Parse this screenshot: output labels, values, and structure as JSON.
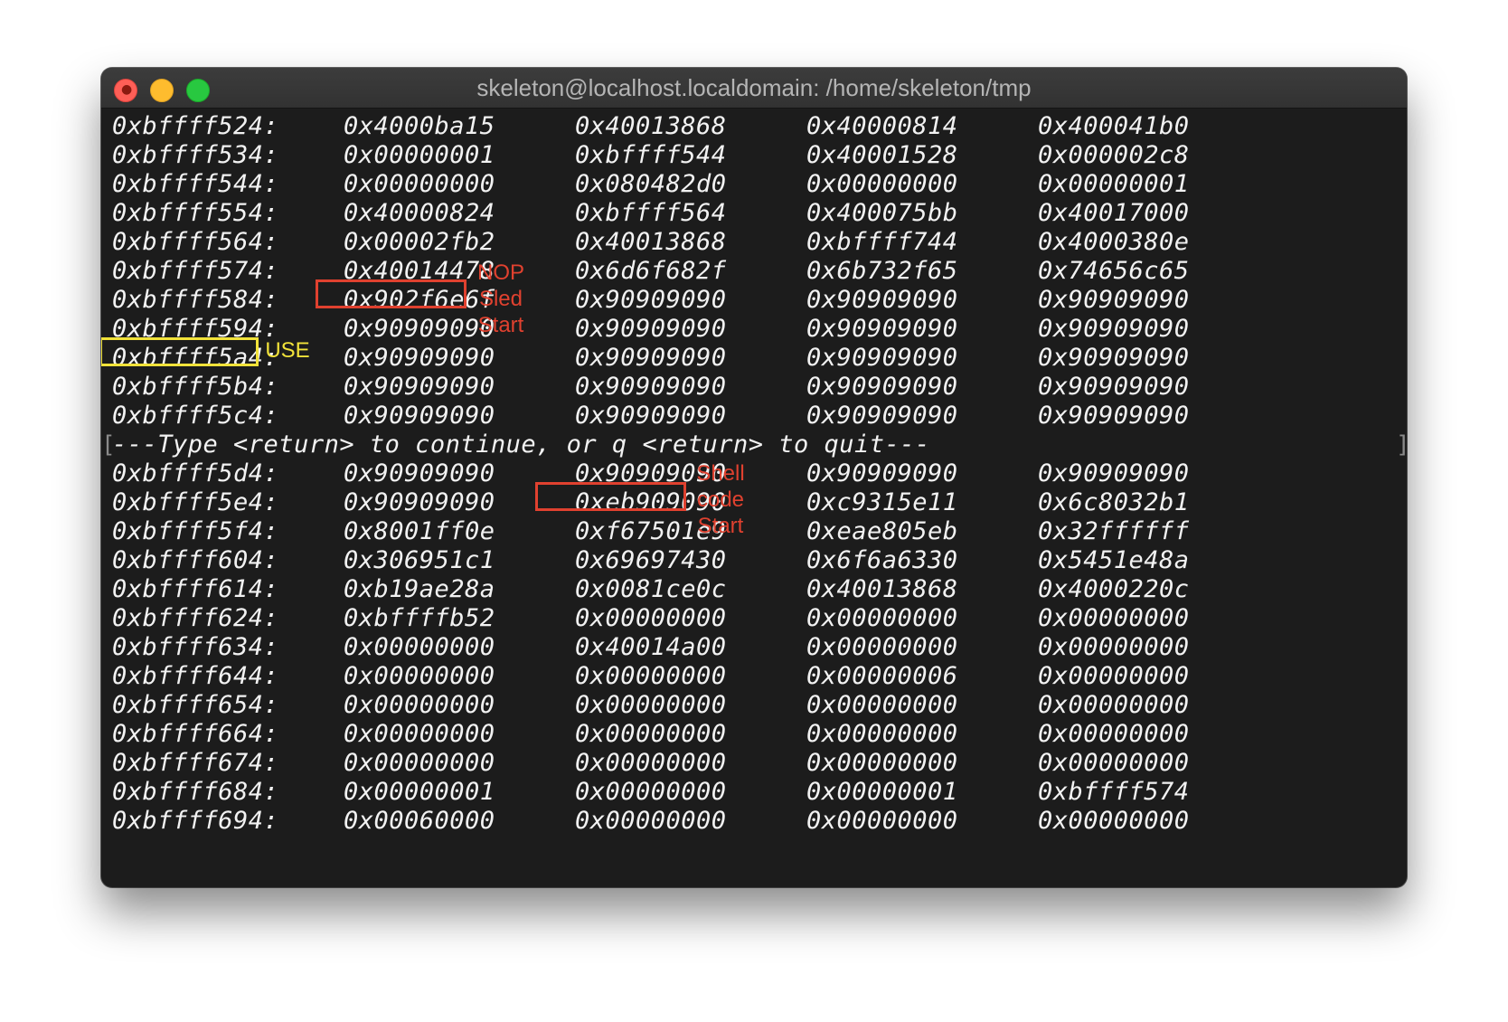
{
  "window": {
    "title": "skeleton@localhost.localdomain: /home/skeleton/tmp",
    "controls": {
      "close": "close-button",
      "minimize": "minimize-button",
      "zoom": "zoom-button"
    }
  },
  "colors": {
    "terminal_bg": "#1c1c1c",
    "text": "#f2f2f2",
    "highlight_red": "#e0412f",
    "highlight_yellow": "#f1e23a"
  },
  "rows": [
    [
      "0xbffff524:",
      "0x4000ba15",
      "0x40013868",
      "0x40000814",
      "0x400041b0"
    ],
    [
      "0xbffff534:",
      "0x00000001",
      "0xbffff544",
      "0x40001528",
      "0x000002c8"
    ],
    [
      "0xbffff544:",
      "0x00000000",
      "0x080482d0",
      "0x00000000",
      "0x00000001"
    ],
    [
      "0xbffff554:",
      "0x40000824",
      "0xbffff564",
      "0x400075bb",
      "0x40017000"
    ],
    [
      "0xbffff564:",
      "0x00002fb2",
      "0x40013868",
      "0xbffff744",
      "0x4000380e"
    ],
    [
      "0xbffff574:",
      "0x40014478",
      "0x6d6f682f",
      "0x6b732f65",
      "0x74656c65"
    ],
    [
      "0xbffff584:",
      "0x902f6e6f",
      "0x90909090",
      "0x90909090",
      "0x90909090"
    ],
    [
      "0xbffff594:",
      "0x90909090",
      "0x90909090",
      "0x90909090",
      "0x90909090"
    ],
    [
      "0xbffff5a4:",
      "0x90909090",
      "0x90909090",
      "0x90909090",
      "0x90909090"
    ],
    [
      "0xbffff5b4:",
      "0x90909090",
      "0x90909090",
      "0x90909090",
      "0x90909090"
    ],
    [
      "0xbffff5c4:",
      "0x90909090",
      "0x90909090",
      "0x90909090",
      "0x90909090"
    ]
  ],
  "prompt": "---Type <return> to continue, or q <return> to quit---",
  "rows2": [
    [
      "0xbffff5d4:",
      "0x90909090",
      "0x90909090",
      "0x90909090",
      "0x90909090"
    ],
    [
      "0xbffff5e4:",
      "0x90909090",
      "0xeb909090",
      "0xc9315e11",
      "0x6c8032b1"
    ],
    [
      "0xbffff5f4:",
      "0x8001ff0e",
      "0xf67501e9",
      "0xeae805eb",
      "0x32ffffff"
    ],
    [
      "0xbffff604:",
      "0x306951c1",
      "0x69697430",
      "0x6f6a6330",
      "0x5451e48a"
    ],
    [
      "0xbffff614:",
      "0xb19ae28a",
      "0x0081ce0c",
      "0x40013868",
      "0x4000220c"
    ],
    [
      "0xbffff624:",
      "0xbffffb52",
      "0x00000000",
      "0x00000000",
      "0x00000000"
    ],
    [
      "0xbffff634:",
      "0x00000000",
      "0x40014a00",
      "0x00000000",
      "0x00000000"
    ],
    [
      "0xbffff644:",
      "0x00000000",
      "0x00000000",
      "0x00000006",
      "0x00000000"
    ],
    [
      "0xbffff654:",
      "0x00000000",
      "0x00000000",
      "0x00000000",
      "0x00000000"
    ],
    [
      "0xbffff664:",
      "0x00000000",
      "0x00000000",
      "0x00000000",
      "0x00000000"
    ],
    [
      "0xbffff674:",
      "0x00000000",
      "0x00000000",
      "0x00000000",
      "0x00000000"
    ],
    [
      "0xbffff684:",
      "0x00000001",
      "0x00000000",
      "0x00000001",
      "0xbffff574"
    ],
    [
      "0xbffff694:",
      "0x00060000",
      "0x00000000",
      "0x00000000",
      "0x00000000"
    ]
  ],
  "annotations": {
    "nop": [
      "NOP",
      "Sled",
      "Start"
    ],
    "use": "USE",
    "shell": [
      "Shell",
      "code",
      "Start"
    ]
  }
}
